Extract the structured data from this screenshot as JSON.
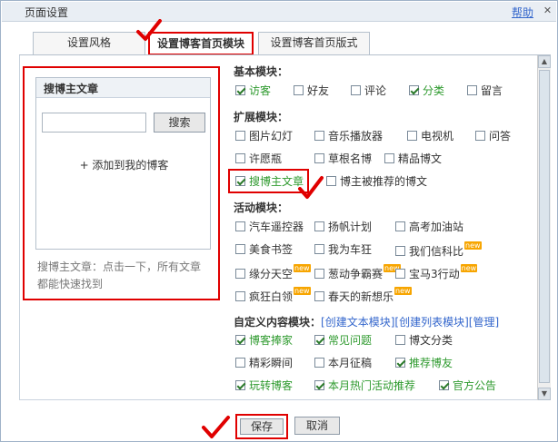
{
  "dialog": {
    "title": "页面设置",
    "help": "帮助",
    "close": "✕"
  },
  "tabs": [
    {
      "label": "设置风格",
      "active": false
    },
    {
      "label": "设置博客首页模块",
      "active": true
    },
    {
      "label": "设置博客首页版式",
      "active": false
    }
  ],
  "preview": {
    "box_title": "搜博主文章",
    "search_value": "",
    "search_button": "搜索",
    "add_link": "+ 添加到我的博客",
    "description": "搜博主文章：点击一下，所有文章都能快速找到"
  },
  "sections": {
    "basic": {
      "title": "基本模块：",
      "items": [
        {
          "label": "访客",
          "checked": true
        },
        {
          "label": "好友",
          "checked": false
        },
        {
          "label": "评论",
          "checked": false
        },
        {
          "label": "分类",
          "checked": true
        },
        {
          "label": "留言",
          "checked": false
        }
      ]
    },
    "extended": {
      "title": "扩展模块：",
      "items": [
        {
          "label": "图片幻灯",
          "checked": false
        },
        {
          "label": "音乐播放器",
          "checked": false
        },
        {
          "label": "电视机",
          "checked": false
        },
        {
          "label": "问答",
          "checked": false
        },
        {
          "label": "许愿瓶",
          "checked": false
        },
        {
          "label": "草根名博",
          "checked": false
        },
        {
          "label": "精品博文",
          "checked": false
        },
        {
          "label": "搜博主文章",
          "checked": true
        },
        {
          "label": "博主被推荐的博文",
          "checked": false
        }
      ]
    },
    "activity": {
      "title": "活动模块：",
      "items": [
        {
          "label": "汽车遥控器",
          "checked": false,
          "new": false
        },
        {
          "label": "扬帆计划",
          "checked": false,
          "new": false
        },
        {
          "label": "高考加油站",
          "checked": false,
          "new": false
        },
        {
          "label": "美食书签",
          "checked": false,
          "new": false
        },
        {
          "label": "我为车狂",
          "checked": false,
          "new": false
        },
        {
          "label": "我们信科比",
          "checked": false,
          "new": true
        },
        {
          "label": "缘分天空",
          "checked": false,
          "new": true
        },
        {
          "label": "葱动争霸赛",
          "checked": false,
          "new": true
        },
        {
          "label": "宝马3行动",
          "checked": false,
          "new": true
        },
        {
          "label": "疯狂白领",
          "checked": false,
          "new": true
        },
        {
          "label": "春天的新想乐",
          "checked": false,
          "new": true
        }
      ]
    },
    "custom": {
      "title": "自定义内容模块：",
      "link_create_text": "[创建文本模块]",
      "link_create_list": "[创建列表模块]",
      "link_manage": "[管理]",
      "items": [
        {
          "label": "博客捧家",
          "checked": true
        },
        {
          "label": "常见问题",
          "checked": true
        },
        {
          "label": "博文分类",
          "checked": false
        },
        {
          "label": "精彩瞬间",
          "checked": false
        },
        {
          "label": "本月征稿",
          "checked": false
        },
        {
          "label": "推荐博友",
          "checked": true
        },
        {
          "label": "玩转博客",
          "checked": true
        },
        {
          "label": "本月热门活动推荐",
          "checked": true
        },
        {
          "label": "官方公告",
          "checked": true
        }
      ]
    }
  },
  "new_badge": "new",
  "buttons": {
    "save": "保存",
    "cancel": "取消"
  },
  "colors": {
    "accent_red": "#e00000",
    "green_label": "#2e9a2e",
    "link_blue": "#3366cc"
  }
}
